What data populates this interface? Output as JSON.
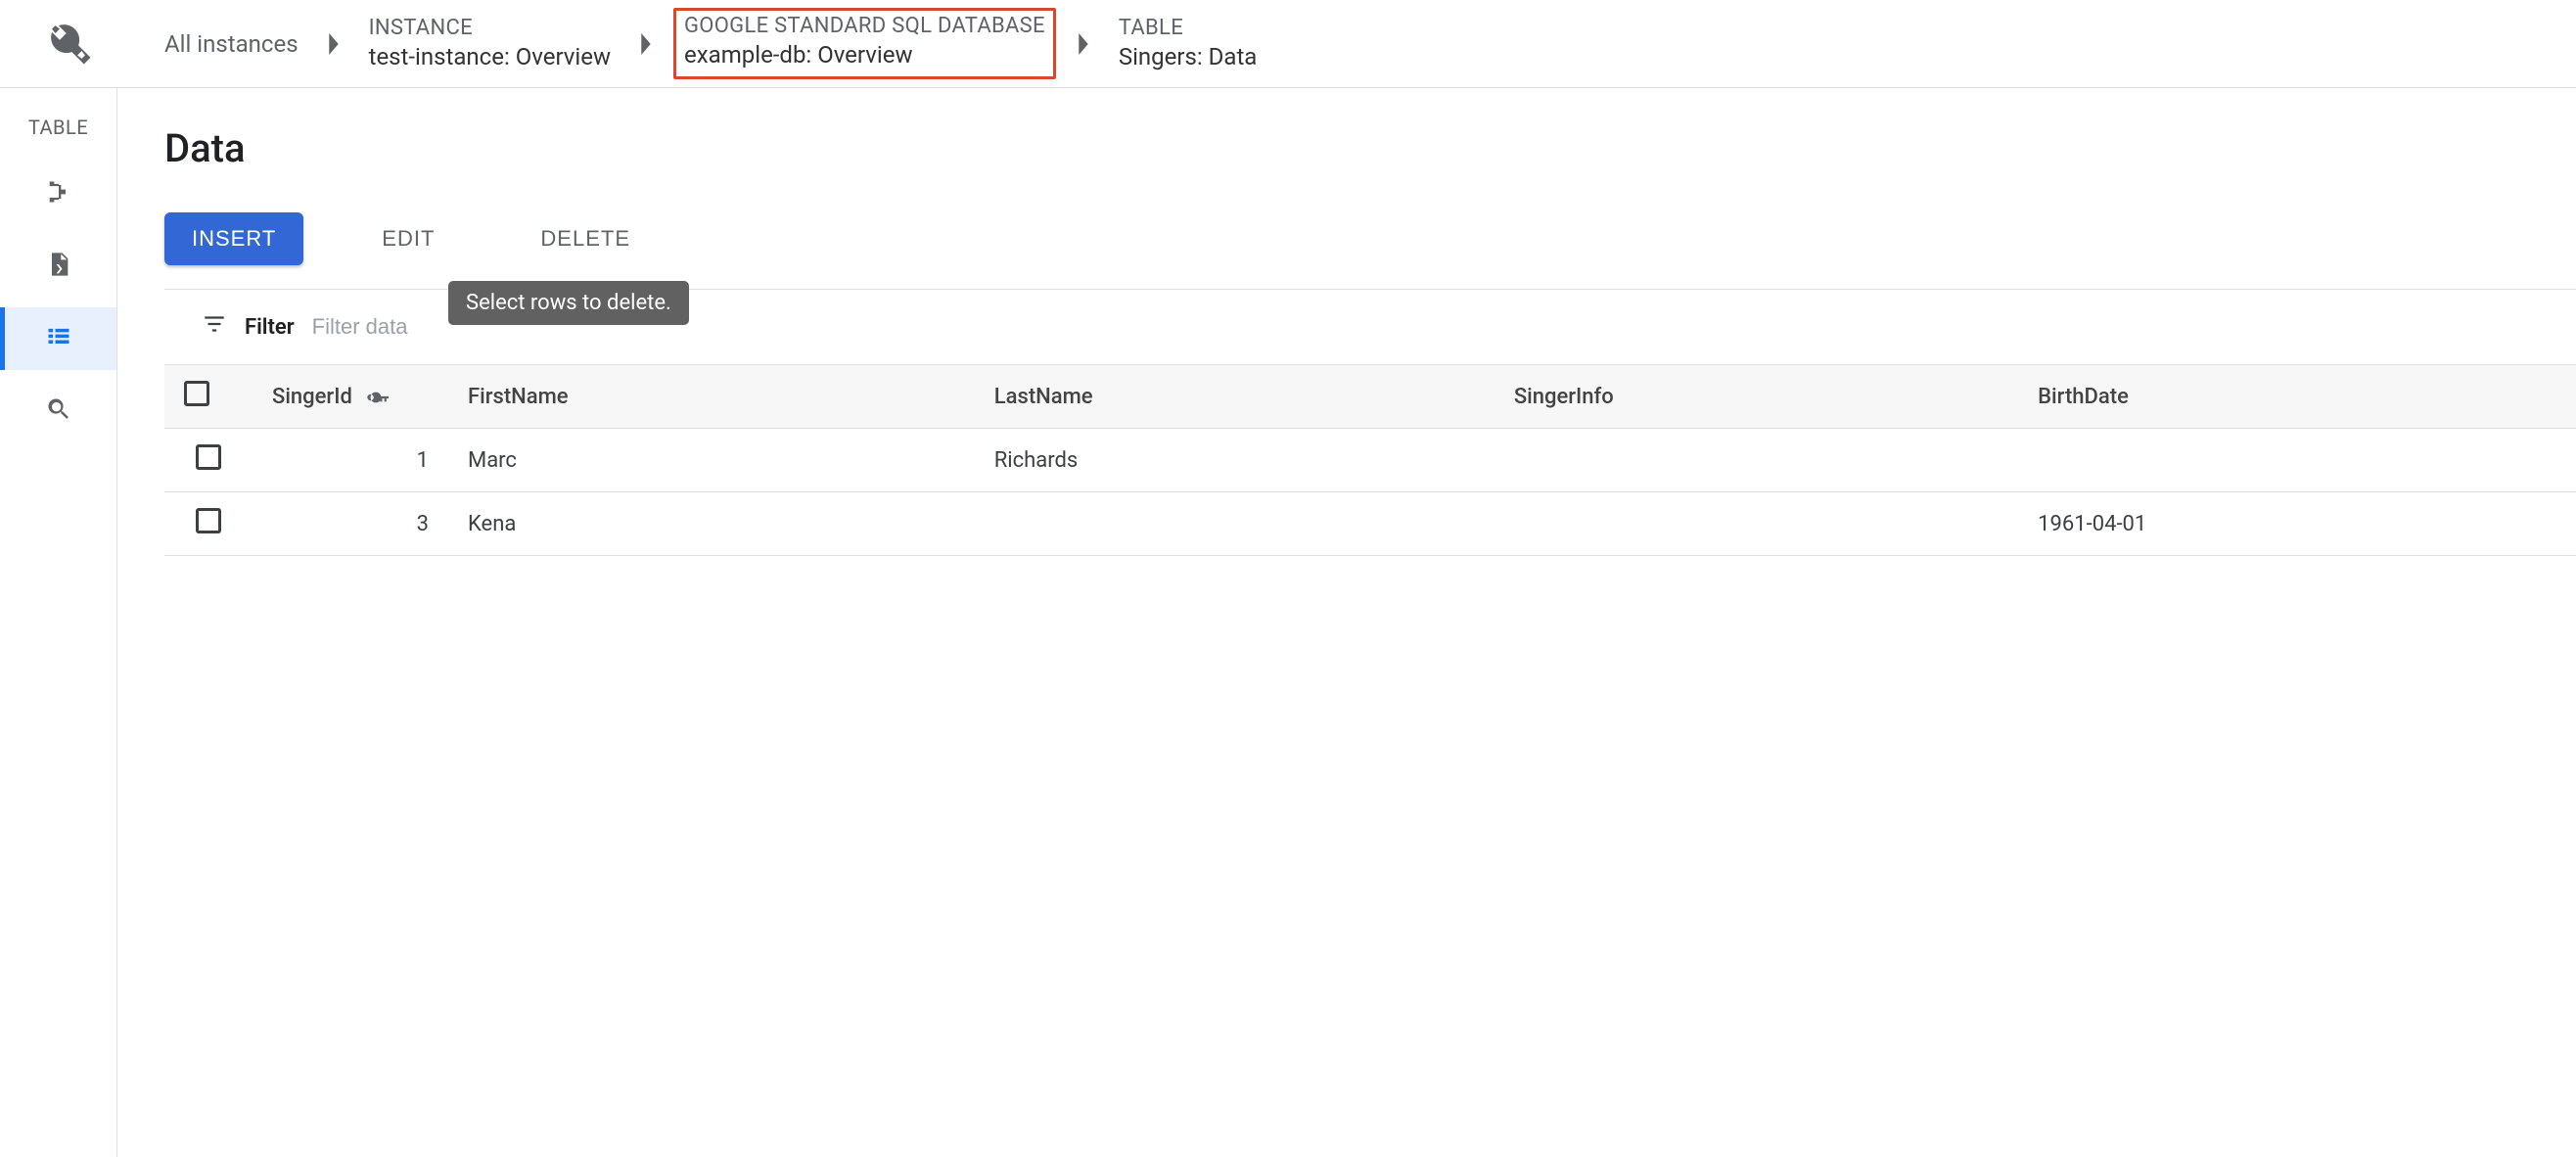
{
  "breadcrumbs": {
    "root": "All instances",
    "instance": {
      "eyebrow": "INSTANCE",
      "main": "test-instance: Overview"
    },
    "database": {
      "eyebrow": "GOOGLE STANDARD SQL DATABASE",
      "main": "example-db: Overview"
    },
    "table": {
      "eyebrow": "TABLE",
      "main": "Singers: Data"
    }
  },
  "rail": {
    "title": "TABLE"
  },
  "page": {
    "title": "Data"
  },
  "actions": {
    "insert": "INSERT",
    "edit": "EDIT",
    "delete": "DELETE",
    "delete_tooltip": "Select rows to delete."
  },
  "filter": {
    "label": "Filter",
    "placeholder": "Filter data"
  },
  "table": {
    "columns": [
      "SingerId",
      "FirstName",
      "LastName",
      "SingerInfo",
      "BirthDate"
    ],
    "rows": [
      {
        "SingerId": "1",
        "FirstName": "Marc",
        "LastName": "Richards",
        "SingerInfo": "",
        "BirthDate": ""
      },
      {
        "SingerId": "3",
        "FirstName": "Kena",
        "LastName": "",
        "SingerInfo": "",
        "BirthDate": "1961-04-01"
      }
    ]
  }
}
